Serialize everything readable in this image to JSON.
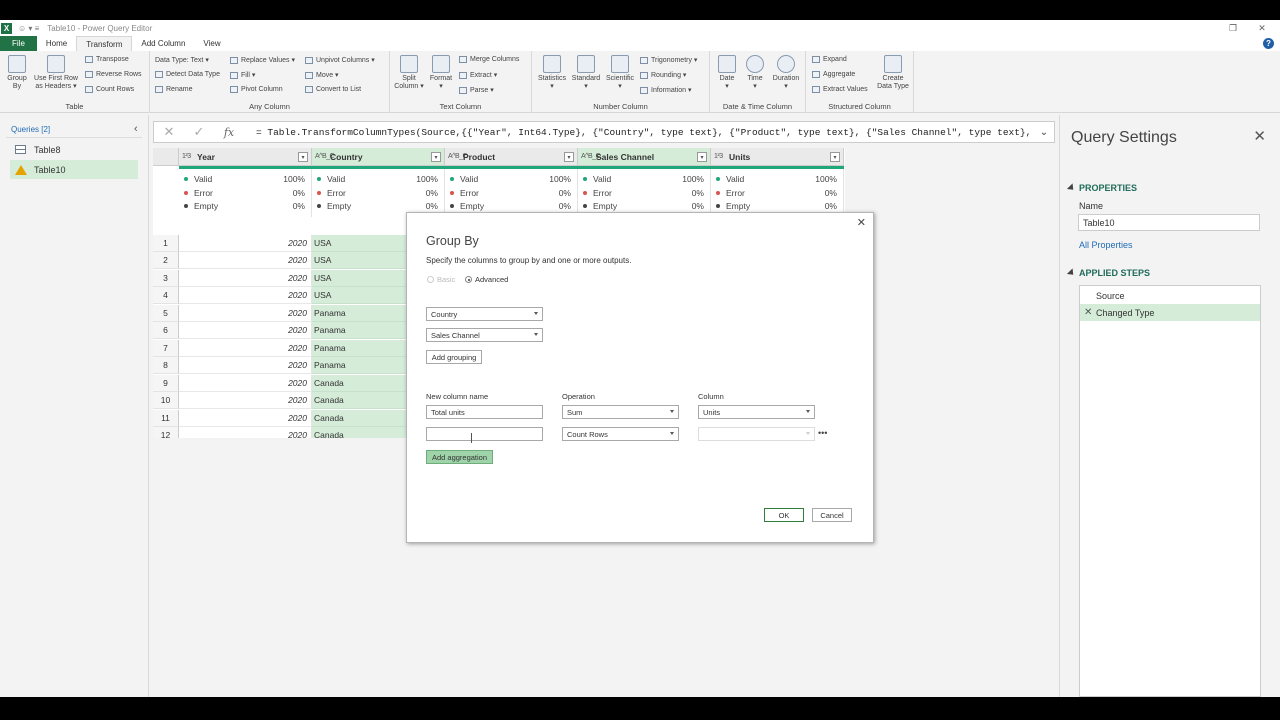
{
  "window": {
    "title": "Table10 - Power Query Editor",
    "quick_access": "☺ ▾ ≡"
  },
  "menu": {
    "file": "File",
    "tabs": [
      "Home",
      "Transform",
      "Add Column",
      "View"
    ],
    "help": "?"
  },
  "ribbon": {
    "groups": [
      {
        "label": "Table",
        "big": [
          {
            "label": "Group\nBy",
            "icon": "group-by-icon"
          },
          {
            "label": "Use First Row\nas Headers ▾",
            "icon": "first-row-headers-icon"
          }
        ],
        "small": [
          "Transpose",
          "Reverse Rows",
          "Count Rows"
        ]
      },
      {
        "label": "Any Column",
        "small": [
          "Data Type: Text ▾",
          "Detect Data Type",
          "Rename",
          "Replace Values ▾",
          "Fill ▾",
          "Pivot Column",
          "Unpivot Columns ▾",
          "Move ▾",
          "Convert to List"
        ]
      },
      {
        "label": "Text Column",
        "big": [
          {
            "label": "Split\nColumn ▾",
            "icon": "split-column-icon"
          },
          {
            "label": "Format\n▾",
            "icon": "format-icon"
          }
        ],
        "small": [
          "Merge Columns",
          "Extract ▾",
          "Parse ▾"
        ]
      },
      {
        "label": "Number Column",
        "big": [
          {
            "label": "Statistics\n▾",
            "icon": "statistics-icon"
          },
          {
            "label": "Standard\n▾",
            "icon": "standard-icon"
          },
          {
            "label": "Scientific\n▾",
            "icon": "scientific-icon"
          }
        ],
        "small": [
          "Trigonometry ▾",
          "Rounding ▾",
          "Information ▾"
        ]
      },
      {
        "label": "Date & Time Column",
        "big": [
          {
            "label": "Date\n▾",
            "icon": "date-icon"
          },
          {
            "label": "Time\n▾",
            "icon": "time-icon"
          },
          {
            "label": "Duration\n▾",
            "icon": "duration-icon"
          }
        ]
      },
      {
        "label": "Structured Column",
        "small": [
          "Expand",
          "Aggregate",
          "Extract Values"
        ],
        "big": [
          {
            "label": "Create\nData Type",
            "icon": "create-data-type-icon"
          }
        ]
      }
    ]
  },
  "queries": {
    "header": "Queries [2]",
    "items": [
      "Table8",
      "Table10"
    ]
  },
  "formula": {
    "text": "= Table.TransformColumnTypes(Source,{{\"Year\", Int64.Type}, {\"Country\", type text}, {\"Product\", type text}, {\"Sales Channel\", type text},"
  },
  "grid": {
    "columns": [
      {
        "type": "1²3",
        "name": "Year"
      },
      {
        "type": "A^B_C",
        "name": "Country"
      },
      {
        "type": "A^B_C",
        "name": "Product"
      },
      {
        "type": "A^B_C",
        "name": "Sales Channel"
      },
      {
        "type": "1²3",
        "name": "Units"
      }
    ],
    "profile": [
      {
        "label": "Valid",
        "value": "100%"
      },
      {
        "label": "Error",
        "value": "0%"
      },
      {
        "label": "Empty",
        "value": "0%"
      }
    ],
    "rows": [
      {
        "n": "1",
        "year": "2020",
        "country": "USA"
      },
      {
        "n": "2",
        "year": "2020",
        "country": "USA"
      },
      {
        "n": "3",
        "year": "2020",
        "country": "USA"
      },
      {
        "n": "4",
        "year": "2020",
        "country": "USA"
      },
      {
        "n": "5",
        "year": "2020",
        "country": "Panama"
      },
      {
        "n": "6",
        "year": "2020",
        "country": "Panama"
      },
      {
        "n": "7",
        "year": "2020",
        "country": "Panama"
      },
      {
        "n": "8",
        "year": "2020",
        "country": "Panama"
      },
      {
        "n": "9",
        "year": "2020",
        "country": "Canada"
      },
      {
        "n": "10",
        "year": "2020",
        "country": "Canada"
      },
      {
        "n": "11",
        "year": "2020",
        "country": "Canada"
      },
      {
        "n": "12",
        "year": "2020",
        "country": "Canada"
      }
    ]
  },
  "settings": {
    "title": "Query Settings",
    "properties_header": "PROPERTIES",
    "name_label": "Name",
    "name_value": "Table10",
    "all_properties": "All Properties",
    "steps_header": "APPLIED STEPS",
    "steps": [
      "Source",
      "Changed Type"
    ]
  },
  "dialog": {
    "title": "Group By",
    "description": "Specify the columns to group by and one or more outputs.",
    "radio_basic": "Basic",
    "radio_advanced": "Advanced",
    "group_by_1": "Country",
    "group_by_2": "Sales Channel",
    "add_grouping": "Add grouping",
    "col_new_name": "New column name",
    "col_operation": "Operation",
    "col_column": "Column",
    "agg1_name": "Total units",
    "agg1_op": "Sum",
    "agg1_col": "Units",
    "agg2_name": "",
    "agg2_op": "Count Rows",
    "agg2_col": "",
    "more": "•••",
    "add_aggregation": "Add aggregation",
    "ok": "OK",
    "cancel": "Cancel"
  },
  "colors": {
    "accent_green": "#217346",
    "selection_green": "#d5ecd9",
    "quality_bar": "#1fa67a",
    "valid_dot": "#1fa67a",
    "error_dot": "#d9534f",
    "empty_dot": "#444444",
    "link_blue": "#1f6bb5"
  }
}
